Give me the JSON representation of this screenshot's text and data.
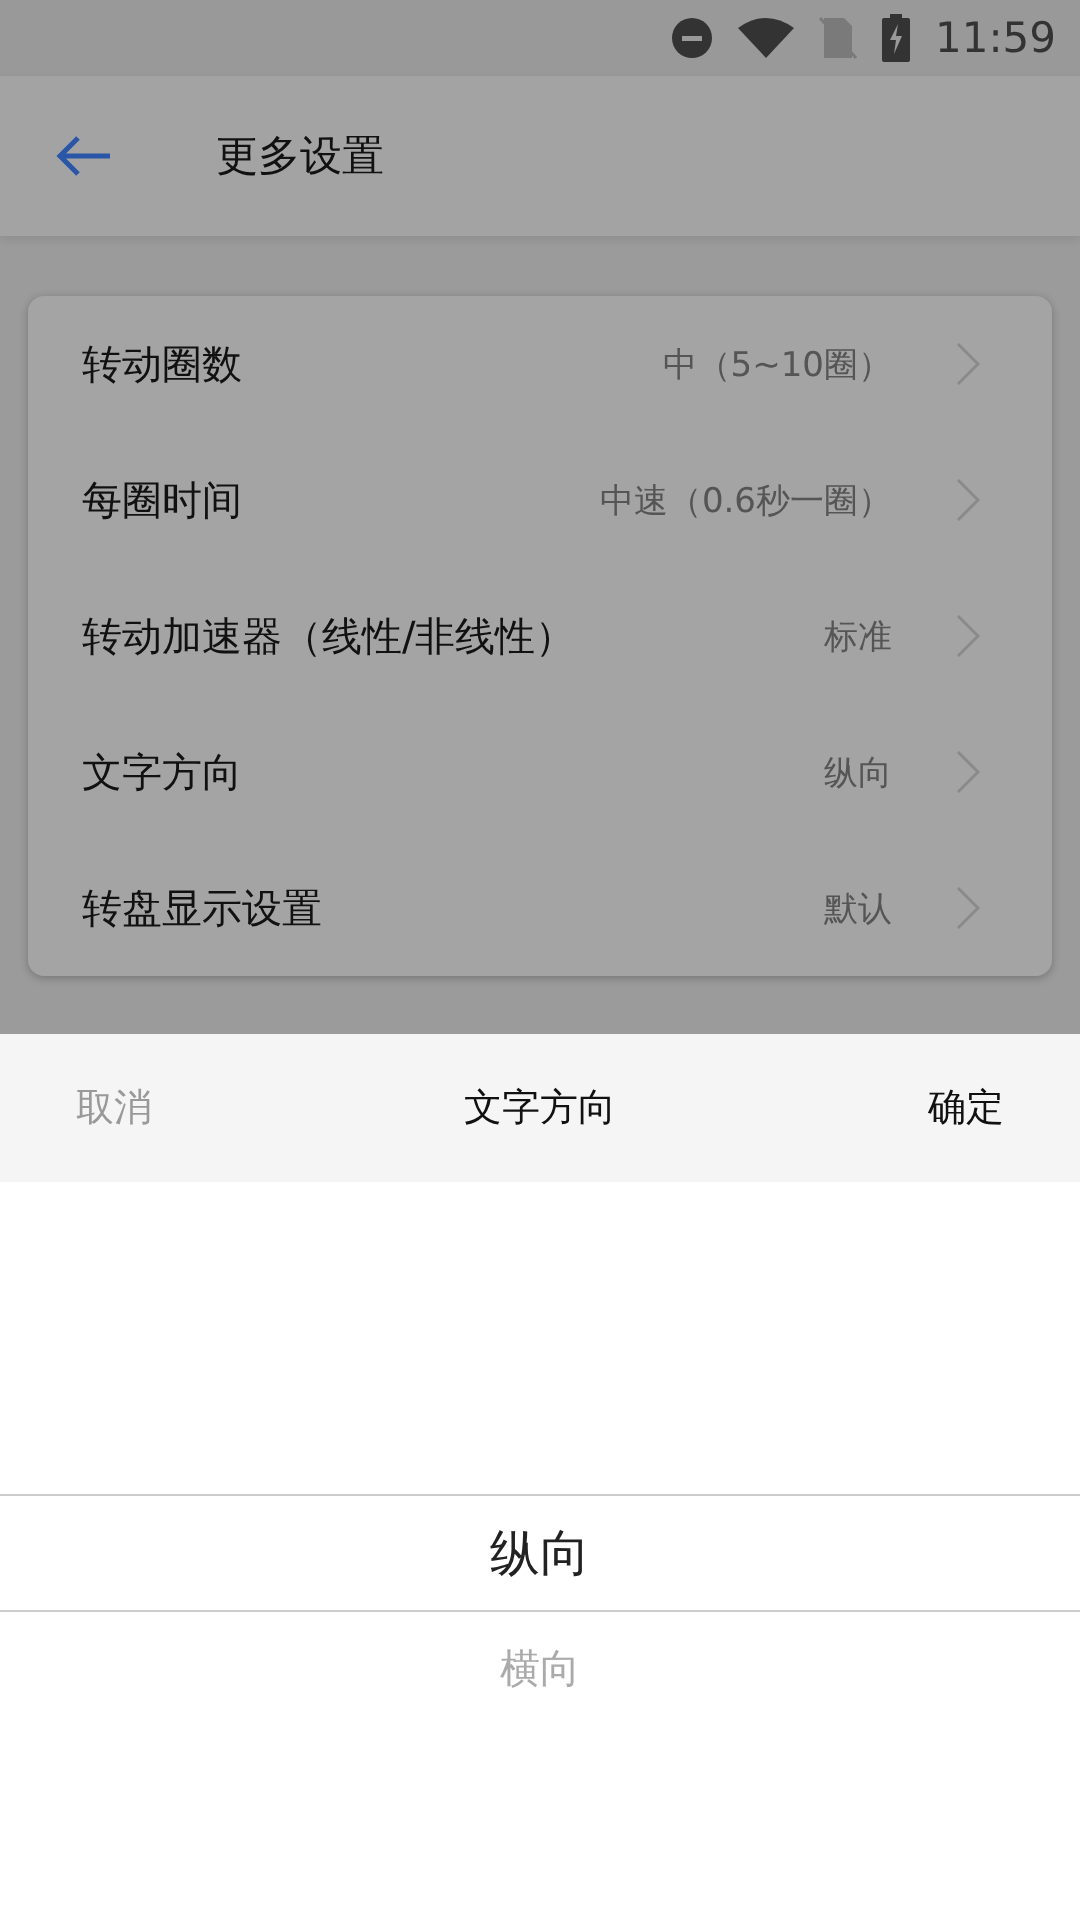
{
  "status_bar": {
    "time": "11:59"
  },
  "header": {
    "title": "更多设置"
  },
  "settings": [
    {
      "label": "转动圈数",
      "value": "中（5~10圈）"
    },
    {
      "label": "每圈时间",
      "value": "中速（0.6秒一圈）"
    },
    {
      "label": "转动加速器（线性/非线性）",
      "value": "标准"
    },
    {
      "label": "文字方向",
      "value": "纵向"
    },
    {
      "label": "转盘显示设置",
      "value": "默认"
    }
  ],
  "picker_sheet": {
    "cancel": "取消",
    "title": "文字方向",
    "confirm": "确定",
    "options": [
      {
        "label": "纵向",
        "selected": true
      },
      {
        "label": "横向",
        "selected": false
      }
    ]
  }
}
